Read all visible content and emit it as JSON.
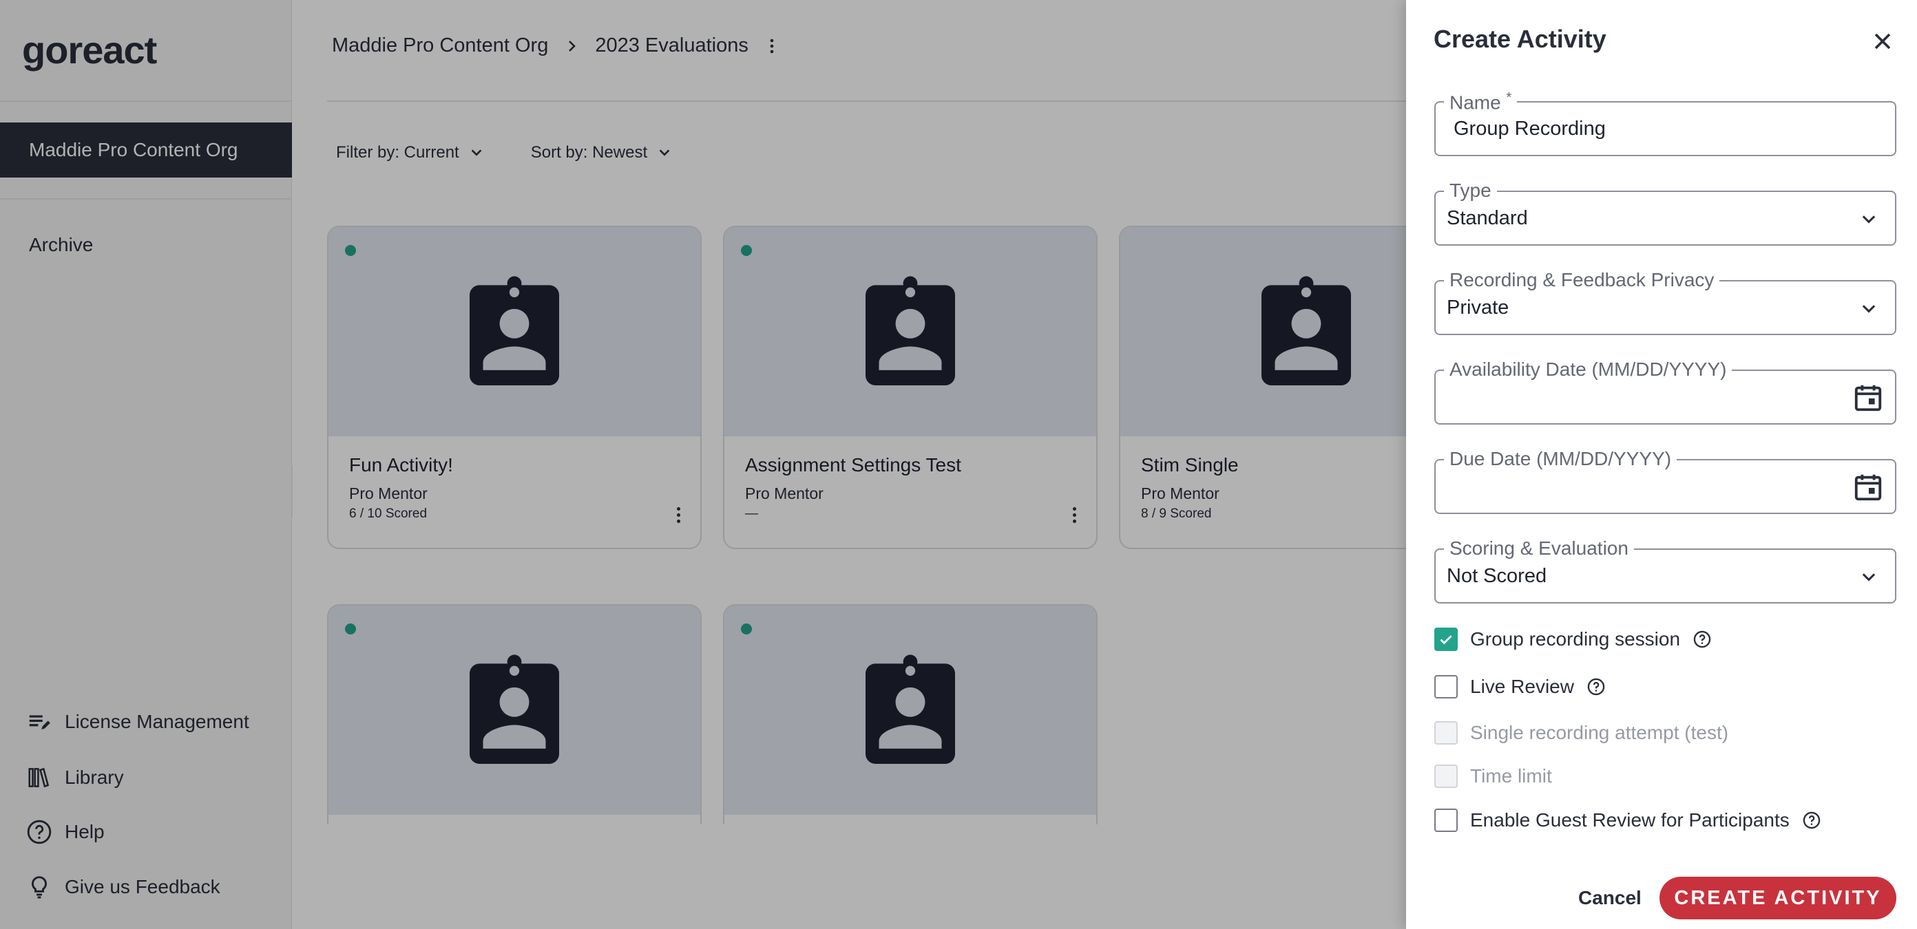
{
  "sidebar": {
    "logo": "goreact",
    "org": "Maddie Pro Content Org",
    "archive": "Archive",
    "bottom": [
      {
        "label": "License Management",
        "icon": "license-icon"
      },
      {
        "label": "Library",
        "icon": "library-icon"
      },
      {
        "label": "Help",
        "icon": "help-circle-icon"
      },
      {
        "label": "Give us Feedback",
        "icon": "lightbulb-icon"
      }
    ]
  },
  "header": {
    "breadcrumb": [
      "Maddie Pro Content Org",
      "2023 Evaluations"
    ]
  },
  "filters": {
    "filter_label": "Filter by: Current",
    "sort_label": "Sort by: Newest"
  },
  "cards": [
    {
      "title": "Fun Activity!",
      "sub": "Pro Mentor",
      "score": "6 / 10 Scored"
    },
    {
      "title": "Assignment Settings Test",
      "sub": "Pro Mentor",
      "score": "—"
    },
    {
      "title": "Stim Single",
      "sub": "Pro Mentor",
      "score": "8 / 9 Scored"
    }
  ],
  "drawer": {
    "title": "Create Activity",
    "name_label": "Name",
    "name_required": "*",
    "name_value": "Group Recording",
    "type_label": "Type",
    "type_value": "Standard",
    "privacy_label": "Recording & Feedback Privacy",
    "privacy_value": "Private",
    "availability_label": "Availability Date (MM/DD/YYYY)",
    "due_label": "Due Date (MM/DD/YYYY)",
    "scoring_label": "Scoring & Evaluation",
    "scoring_value": "Not Scored",
    "checks": [
      {
        "label": "Group recording session",
        "checked": true,
        "disabled": false,
        "help": true
      },
      {
        "label": "Live Review",
        "checked": false,
        "disabled": false,
        "help": true
      },
      {
        "label": "Single recording attempt (test)",
        "checked": false,
        "disabled": true,
        "help": false
      },
      {
        "label": "Time limit",
        "checked": false,
        "disabled": true,
        "help": false
      },
      {
        "label": "Enable Guest Review for Participants",
        "checked": false,
        "disabled": false,
        "help": true
      }
    ],
    "cancel_label": "Cancel",
    "create_label": "CREATE ACTIVITY"
  },
  "colors": {
    "primary_dark": "#2a2e3b",
    "accent_teal": "#23a38c",
    "create_red": "#c8323c"
  }
}
